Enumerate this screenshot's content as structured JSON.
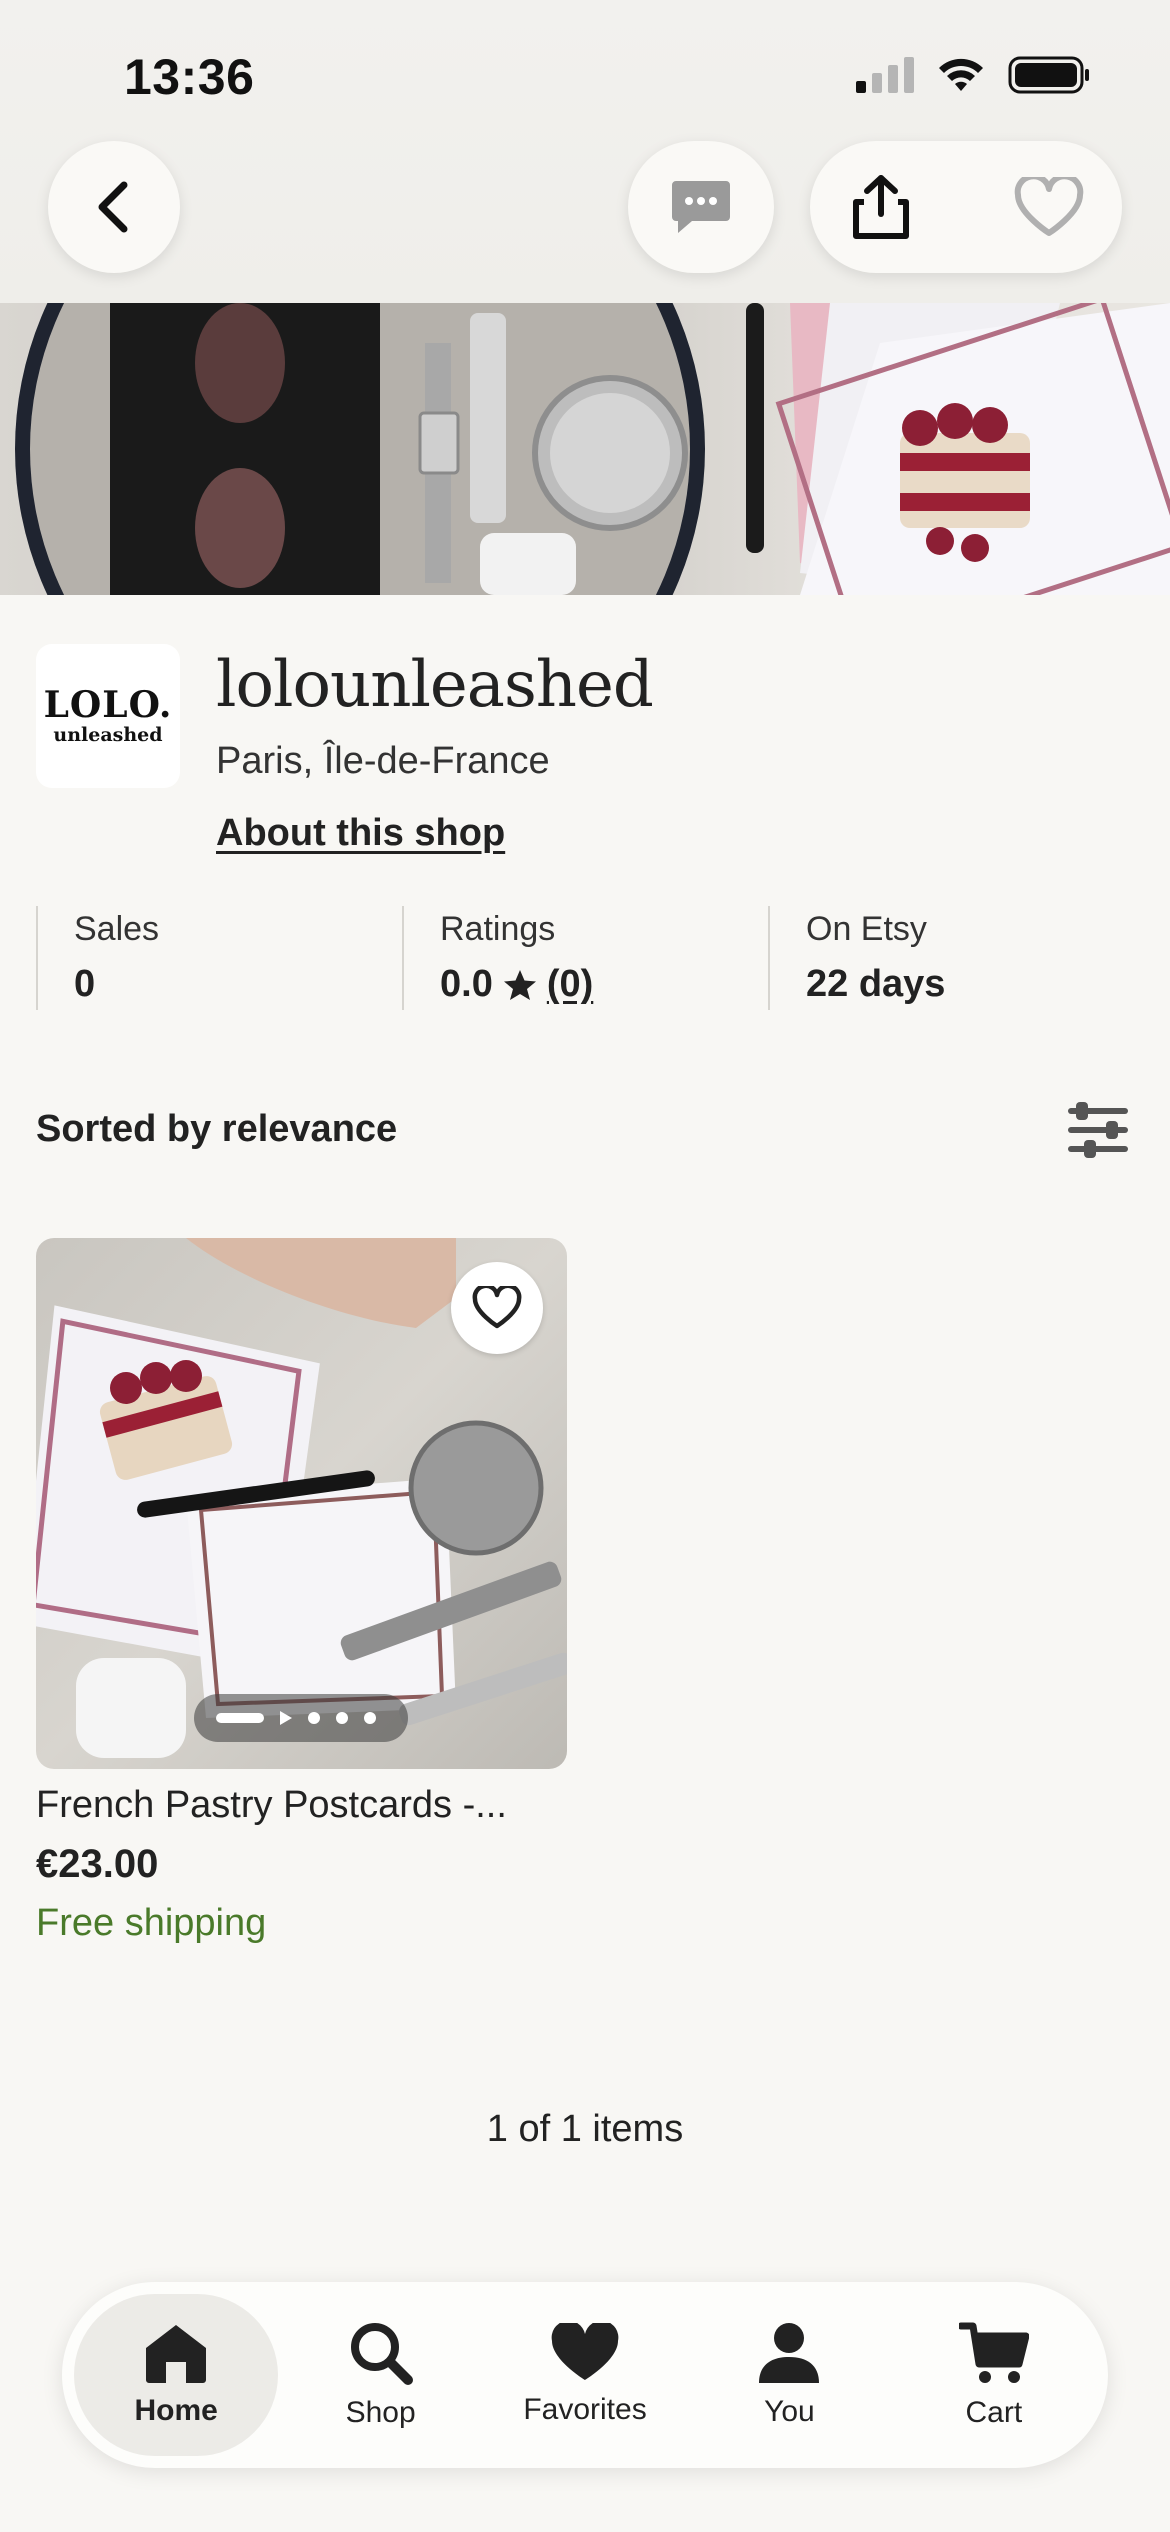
{
  "status_bar": {
    "time": "13:36"
  },
  "header": {
    "back_icon": "chevron-left-icon",
    "message_icon": "chat-bubble-icon",
    "share_icon": "share-icon",
    "favorite_icon": "heart-outline-icon"
  },
  "shop": {
    "logo_line1": "LOLO.",
    "logo_line2": "unleashed",
    "name": "lolounleashed",
    "location": "Paris, Île-de-France",
    "about_link": "About this shop"
  },
  "stats": [
    {
      "label": "Sales",
      "value": "0"
    },
    {
      "label": "Ratings",
      "value": "0.0",
      "count": "(0)"
    },
    {
      "label": "On Etsy",
      "value": "22 days"
    }
  ],
  "sort": {
    "label": "Sorted by relevance",
    "filter_icon": "sliders-icon"
  },
  "listings": [
    {
      "title": "French Pastry Postcards -...",
      "price": "€23.00",
      "shipping": "Free shipping",
      "image_count": 5,
      "current_image": 1
    }
  ],
  "pagination": {
    "label": "1 of 1 items"
  },
  "tab_bar": {
    "tabs": [
      {
        "label": "Home",
        "icon": "home-icon",
        "active": true
      },
      {
        "label": "Shop",
        "icon": "search-icon",
        "active": false
      },
      {
        "label": "Favorites",
        "icon": "heart-icon",
        "active": false
      },
      {
        "label": "You",
        "icon": "person-icon",
        "active": false
      },
      {
        "label": "Cart",
        "icon": "cart-icon",
        "active": false
      }
    ]
  },
  "colors": {
    "background": "#f8f7f4",
    "shipping_green": "#4a7a2a",
    "active_tab": "#ecebe7"
  }
}
